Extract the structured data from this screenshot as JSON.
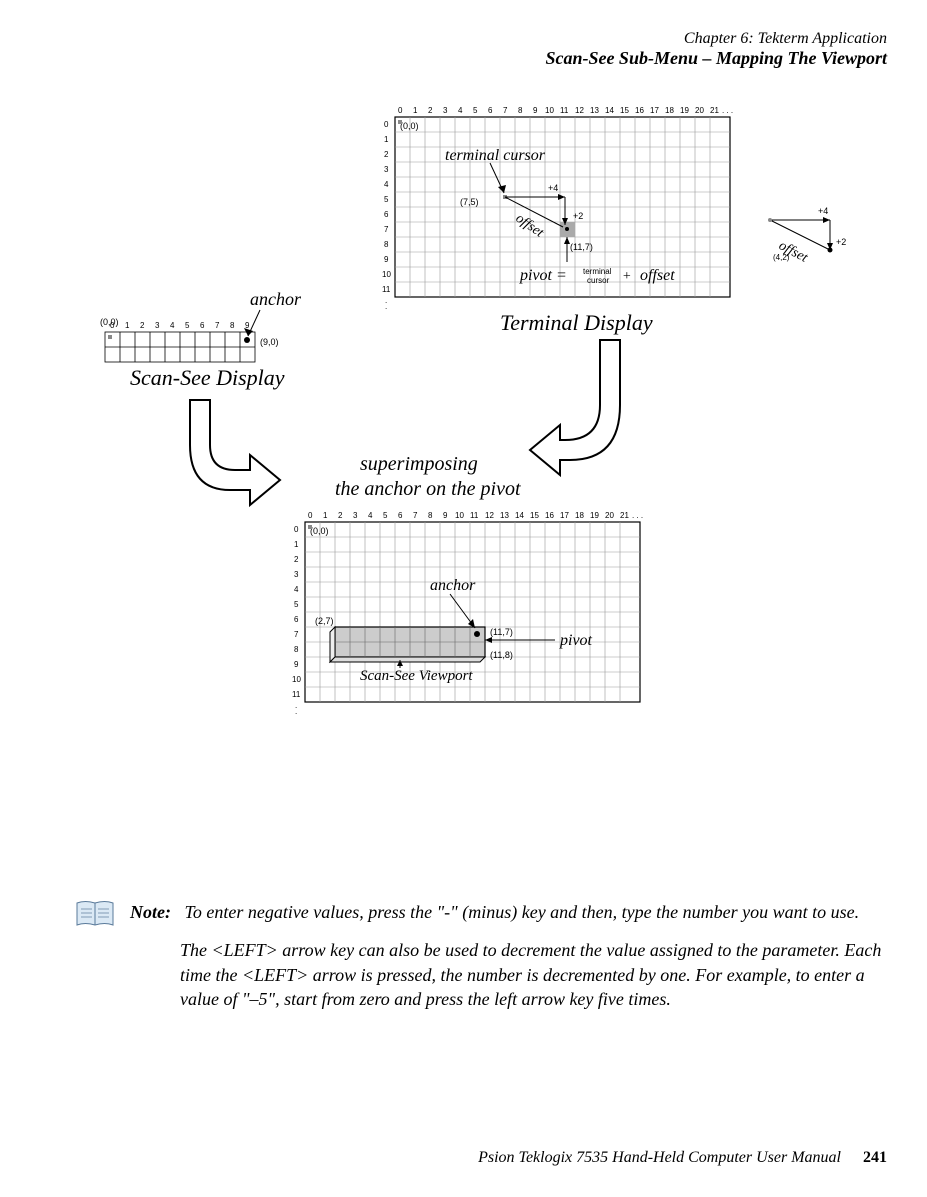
{
  "header": {
    "chapter": "Chapter 6: Tekterm Application",
    "subtitle": "Scan-See Sub-Menu – Mapping The Viewport"
  },
  "diagram": {
    "anchor_label_top": "anchor",
    "scan_see_display": "Scan-See Display",
    "terminal_display": "Terminal Display",
    "terminal_cursor_label": "terminal cursor",
    "pt00_a": "(0,0)",
    "pt90": "(9,0)",
    "pt00_b": "(0,0)",
    "pt75": "(7,5)",
    "pt117": "(11,7)",
    "plus4": "+4",
    "plus2": "+2",
    "offset": "offset",
    "offset42": "(4,2)",
    "pivot_eq": "pivot =",
    "tc_small1": "terminal",
    "tc_small2": "cursor",
    "plus_word": "+",
    "offset_word": "offset",
    "superimposing1": "superimposing",
    "superimposing2": "the anchor on the pivot",
    "pt00_c": "(0,0)",
    "pt27": "(2,7)",
    "pt117_b": "(11,7)",
    "pt118": "(11,8)",
    "anchor_label_bot": "anchor",
    "pivot_label_bot": "pivot",
    "scan_see_viewport": "Scan-See Viewport"
  },
  "note": {
    "label": "Note:",
    "p1": "To enter negative values, press the \"-\" (minus) key and then, type the number you want to use.",
    "p2": "The <LEFT> arrow key can also be used to decrement the value assigned to the parameter. Each time the <LEFT> arrow is pressed, the number is decremented by one. For example, to enter a value of \"–5\", start from zero and press the left arrow key five times."
  },
  "footer": {
    "title": "Psion Teklogix 7535 Hand-Held Computer User Manual",
    "page": "241"
  }
}
